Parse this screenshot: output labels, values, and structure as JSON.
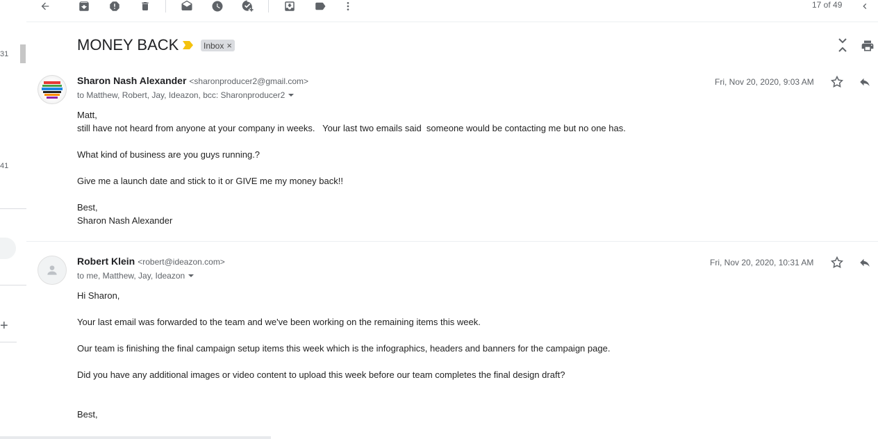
{
  "toolbar": {
    "counter": "17 of 49",
    "icons": [
      "back-arrow-icon",
      "archive-icon",
      "report-spam-icon",
      "delete-icon",
      "mark-unread-icon",
      "snooze-icon",
      "add-task-icon",
      "move-to-icon",
      "label-icon",
      "more-icon"
    ]
  },
  "left_strip": {
    "num1": "31",
    "num2": "41",
    "plus": "+"
  },
  "thread": {
    "subject": "MONEY BACK",
    "label": "Inbox",
    "label_close": "×"
  },
  "messages": [
    {
      "sender_name": "Sharon Nash Alexander",
      "sender_email": "<sharonproducer2@gmail.com>",
      "recipients": "to Matthew, Robert, Jay, Ideazon, bcc: Sharonproducer2",
      "date": "Fri, Nov 20, 2020, 9:03 AM",
      "body": [
        "Matt,",
        "still have not heard from anyone at your company in weeks.   Your last two emails said  someone would be contacting me but no one has.",
        "",
        "What kind of business are you guys running.?",
        "",
        "Give me a launch date and stick to it or GIVE me my money back!!",
        "",
        "Best,",
        "Sharon Nash Alexander"
      ]
    },
    {
      "sender_name": "Robert Klein",
      "sender_email": "<robert@ideazon.com>",
      "recipients": "to me, Matthew, Jay, Ideazon",
      "date": "Fri, Nov 20, 2020, 10:31 AM",
      "body": [
        "Hi Sharon,",
        "",
        "Your last email was forwarded to the team and we've been working on the remaining items this week.",
        "",
        "Our team is finishing the final campaign setup items this week which is the infographics, headers and banners for the campaign page.",
        "",
        "Did you have any additional images or video content to upload this week before our team completes the final design draft?",
        "",
        "",
        "Best,"
      ]
    }
  ]
}
